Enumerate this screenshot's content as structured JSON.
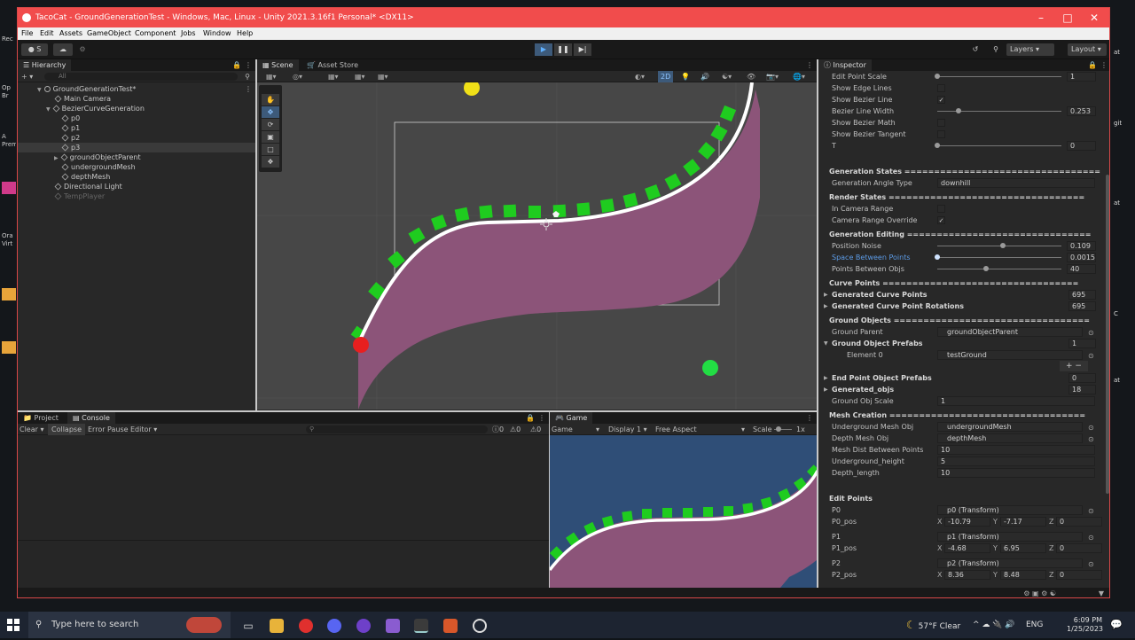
{
  "window": {
    "title": "TacoCat - GroundGenerationTest - Windows, Mac, Linux - Unity 2021.3.16f1 Personal* <DX11>"
  },
  "menu": [
    "File",
    "Edit",
    "Assets",
    "GameObject",
    "Component",
    "Jobs",
    "Window",
    "Help"
  ],
  "toolbar": {
    "account": "S",
    "layers": "Layers",
    "layout": "Layout"
  },
  "hierarchy": {
    "tab": "Hierarchy",
    "search_placeholder": "All",
    "items": [
      {
        "label": "GroundGenerationTest*",
        "depth": 0
      },
      {
        "label": "Main Camera",
        "depth": 1
      },
      {
        "label": "BezierCurveGeneration",
        "depth": 1
      },
      {
        "label": "p0",
        "depth": 2
      },
      {
        "label": "p1",
        "depth": 2
      },
      {
        "label": "p2",
        "depth": 2
      },
      {
        "label": "p3",
        "depth": 2
      },
      {
        "label": "groundObjectParent",
        "depth": 2
      },
      {
        "label": "undergroundMesh",
        "depth": 2
      },
      {
        "label": "depthMesh",
        "depth": 2
      },
      {
        "label": "Directional Light",
        "depth": 1
      },
      {
        "label": "TempPlayer",
        "depth": 1
      }
    ]
  },
  "scene": {
    "tabs": [
      "Scene",
      "Asset Store"
    ],
    "mode_2d": "2D"
  },
  "console": {
    "tabs": [
      "Project",
      "Console"
    ],
    "buttons": [
      "Clear",
      "Collapse",
      "Error Pause",
      "Editor"
    ],
    "counts": [
      "0",
      "0",
      "0"
    ]
  },
  "game": {
    "tab": "Game",
    "view": "Game",
    "display": "Display 1",
    "aspect": "Free Aspect",
    "scale_label": "Scale",
    "scale_value": "1x"
  },
  "inspector": {
    "tab": "Inspector",
    "rows": [
      {
        "type": "slider",
        "label": "Edit Point Scale",
        "value": "1",
        "knob": 0.0
      },
      {
        "type": "check",
        "label": "Show Edge Lines",
        "checked": false
      },
      {
        "type": "check",
        "label": "Show Bezier Line",
        "checked": true
      },
      {
        "type": "slider",
        "label": "Bezier Line Width",
        "value": "0.253",
        "knob": 0.17
      },
      {
        "type": "check",
        "label": "Show Bezier Math",
        "checked": false
      },
      {
        "type": "check",
        "label": "Show Bezier Tangent",
        "checked": false
      },
      {
        "type": "slider",
        "label": "T",
        "value": "0",
        "knob": 0.0
      },
      {
        "type": "spacer"
      },
      {
        "type": "header",
        "label": "Generation States ================================="
      },
      {
        "type": "field",
        "label": "Generation Angle Type",
        "value": "downhill"
      },
      {
        "type": "header",
        "label": "Render States ================================="
      },
      {
        "type": "check",
        "label": "In Camera Range",
        "checked": false
      },
      {
        "type": "check",
        "label": "Camera Range Override",
        "checked": true
      },
      {
        "type": "header",
        "label": "Generation Editing ==============================="
      },
      {
        "type": "slider",
        "label": "Position Noise",
        "value": "0.109",
        "knob": 0.53
      },
      {
        "type": "slider",
        "label": "Space Between Points",
        "value": "0.0015",
        "knob": 0.0,
        "highlight": true
      },
      {
        "type": "slider",
        "label": "Points Between Objs",
        "value": "40",
        "knob": 0.39
      },
      {
        "type": "header",
        "label": "Curve Points ================================="
      },
      {
        "type": "fold",
        "label": "Generated Curve Points",
        "value": "695"
      },
      {
        "type": "fold",
        "label": "Generated Curve Point Rotations",
        "value": "695"
      },
      {
        "type": "header",
        "label": "Ground Objects ================================="
      },
      {
        "type": "object",
        "label": "Ground Parent",
        "value": "groundObjectParent"
      },
      {
        "type": "fold-open",
        "label": "Ground Object Prefabs",
        "value": "1"
      },
      {
        "type": "element",
        "label": "Element 0",
        "value": "testGround"
      },
      {
        "type": "plusminus"
      },
      {
        "type": "fold",
        "label": "End Point Object Prefabs",
        "value": "0"
      },
      {
        "type": "fold",
        "label": "Generated_objs",
        "value": "18"
      },
      {
        "type": "field",
        "label": "Ground Obj Scale",
        "value": "1"
      },
      {
        "type": "header",
        "label": "Mesh Creation ================================="
      },
      {
        "type": "object",
        "label": "Underground Mesh Obj",
        "value": "undergroundMesh"
      },
      {
        "type": "object",
        "label": "Depth Mesh Obj",
        "value": "depthMesh"
      },
      {
        "type": "field",
        "label": "Mesh Dist Between Points",
        "value": "10"
      },
      {
        "type": "field",
        "label": "Underground_height",
        "value": "5"
      },
      {
        "type": "field",
        "label": "Depth_length",
        "value": "10"
      },
      {
        "type": "spacer"
      },
      {
        "type": "header",
        "label": "Edit Points"
      },
      {
        "type": "object",
        "label": "P0",
        "value": "p0 (Transform)"
      },
      {
        "type": "xyz",
        "label": "P0_pos",
        "x": "-10.79",
        "y": "-7.17",
        "z": "0"
      },
      {
        "type": "spacer-small"
      },
      {
        "type": "object",
        "label": "P1",
        "value": "p1 (Transform)"
      },
      {
        "type": "xyz",
        "label": "P1_pos",
        "x": "-4.68",
        "y": "6.95",
        "z": "0"
      },
      {
        "type": "spacer-small"
      },
      {
        "type": "object",
        "label": "P2",
        "value": "p2 (Transform)"
      },
      {
        "type": "xyz",
        "label": "P2_pos",
        "x": "8.36",
        "y": "8.48",
        "z": "0"
      }
    ]
  },
  "taskbar": {
    "search_placeholder": "Type here to search",
    "weather": "57°F  Clear",
    "language": "ENG",
    "time": "6:09 PM",
    "date": "1/25/2023"
  },
  "colors": {
    "titlebar": "#f14c4c",
    "curve_fill": "#8c5479",
    "ground_objects": "#1fcc1f",
    "point_red": "#e81f1f",
    "point_green": "#22dd44",
    "point_yellow": "#f0e018",
    "game_bg": "#2f4e77"
  }
}
